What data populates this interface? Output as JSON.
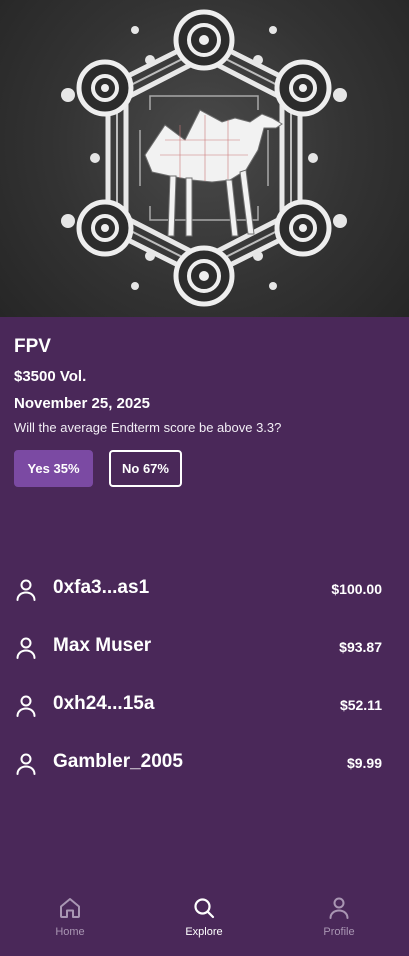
{
  "hero": {
    "image_icon": "camel-hexagon-emblem-icon"
  },
  "market": {
    "title": "FPV",
    "volume": "$3500 Vol.",
    "date": "November 25, 2025",
    "question": "Will the average Endterm score be above 3.3?"
  },
  "choices": {
    "yes_label": "Yes 35%",
    "no_label": "No 67%"
  },
  "bettors": [
    {
      "name": "0xfa3...as1",
      "amount": "$100.00"
    },
    {
      "name": "Max Muser",
      "amount": "$93.87"
    },
    {
      "name": "0xh24...15a",
      "amount": "$52.11"
    },
    {
      "name": "Gambler_2005",
      "amount": "$9.99"
    }
  ],
  "nav": {
    "items": [
      {
        "label": "Home",
        "icon": "home-icon"
      },
      {
        "label": "Explore",
        "icon": "search-icon"
      },
      {
        "label": "Profile",
        "icon": "user-icon"
      }
    ]
  },
  "colors": {
    "background": "#4a2859",
    "accent": "#7b4aa3",
    "nav_inactive": "#a996b3"
  }
}
